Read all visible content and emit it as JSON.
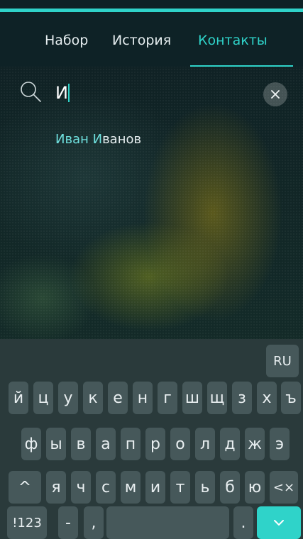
{
  "tabs": [
    {
      "label": "Набор",
      "active": false
    },
    {
      "label": "История",
      "active": false
    },
    {
      "label": "Контакты",
      "active": true
    }
  ],
  "search": {
    "value": "И",
    "placeholder": ""
  },
  "results": [
    {
      "first": "Иван",
      "last_match": "И",
      "last_rest": "ванов"
    }
  ],
  "keyboard": {
    "language": "RU",
    "row1": [
      "й",
      "ц",
      "у",
      "к",
      "е",
      "н",
      "г",
      "ш",
      "щ",
      "з",
      "х",
      "ъ"
    ],
    "row2": [
      "ф",
      "ы",
      "в",
      "а",
      "п",
      "р",
      "о",
      "л",
      "д",
      "ж",
      "э"
    ],
    "row3_shift": "^",
    "row3": [
      "я",
      "ч",
      "с",
      "м",
      "и",
      "т",
      "ь",
      "б",
      "ю"
    ],
    "row3_backspace": "<×",
    "row4": {
      "symbols": "!123",
      "dash": "-",
      "comma": ",",
      "period": "."
    }
  },
  "colors": {
    "accent": "#2fd3c9",
    "keyboard_bg": "#2a3a3b",
    "key_bg": "#46585a"
  },
  "icons": {
    "search": "search-icon",
    "clear": "close-icon",
    "enter": "chevron-down-icon"
  }
}
